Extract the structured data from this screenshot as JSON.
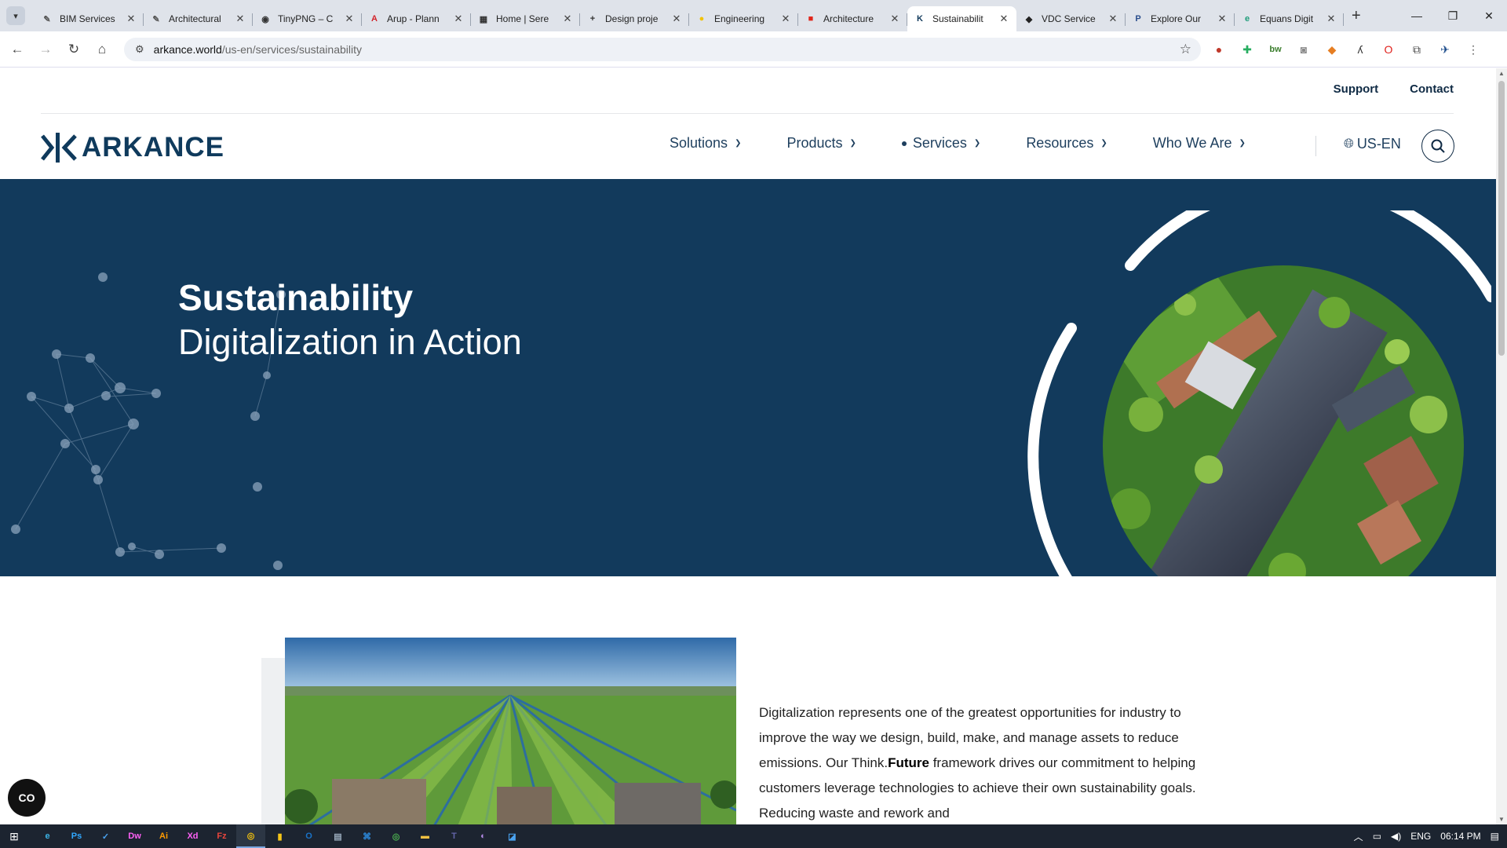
{
  "browser": {
    "tabs": [
      {
        "title": "BIM Services",
        "fav": "✎",
        "fav_color": "#555"
      },
      {
        "title": "Architectural",
        "fav": "✎",
        "fav_color": "#555"
      },
      {
        "title": "TinyPNG – C",
        "fav": "◉",
        "fav_color": "#333"
      },
      {
        "title": "Arup - Plann",
        "fav": "A",
        "fav_color": "#d2232a"
      },
      {
        "title": "Home | Sere",
        "fav": "▦",
        "fav_color": "#333"
      },
      {
        "title": "Design proje",
        "fav": "+",
        "fav_color": "#333"
      },
      {
        "title": "Engineering",
        "fav": "●",
        "fav_color": "#f2c200"
      },
      {
        "title": "Architecture",
        "fav": "■",
        "fav_color": "#e0261b"
      },
      {
        "title": "Sustainabilit",
        "fav": "K",
        "fav_color": "#123a5c",
        "active": true
      },
      {
        "title": "VDC Service",
        "fav": "◆",
        "fav_color": "#222"
      },
      {
        "title": "Explore Our",
        "fav": "P",
        "fav_color": "#2a4e8c"
      },
      {
        "title": "Equans Digit",
        "fav": "e",
        "fav_color": "#1f9d7a"
      }
    ],
    "new_tab": "+",
    "url_host": "arkance.world",
    "url_path": "/us-en/services/sustainability"
  },
  "site": {
    "util_links": [
      "Support",
      "Contact"
    ],
    "logo_text": "ARKANCE",
    "nav": [
      {
        "label": "Solutions"
      },
      {
        "label": "Products"
      },
      {
        "label": "Services",
        "active": true
      },
      {
        "label": "Resources"
      },
      {
        "label": "Who We Are"
      }
    ],
    "locale": "US-EN",
    "hero": {
      "title": "Sustainability",
      "subtitle": "Digitalization in Action"
    },
    "body": {
      "p1_a": "Digitalization represents one of the greatest opportunities for industry to improve the way we design, build, make, and manage assets to reduce emissions. Our Think.",
      "p1_bold": "Future",
      "p1_b": " framework drives our commitment to helping customers leverage technologies to achieve their own sustainability goals. Reducing waste and rework and"
    },
    "a11y_label": "CO"
  },
  "taskbar": {
    "apps": [
      {
        "label": "e",
        "color": "#3cb4e6"
      },
      {
        "label": "Ps",
        "color": "#31a8ff"
      },
      {
        "label": "✓",
        "color": "#4aa3f0"
      },
      {
        "label": "Dw",
        "color": "#ff61f6"
      },
      {
        "label": "Ai",
        "color": "#ff9a00"
      },
      {
        "label": "Xd",
        "color": "#ff61f6"
      },
      {
        "label": "Fz",
        "color": "#e8453c"
      },
      {
        "label": "◎",
        "color": "#f4c20d",
        "running": true
      },
      {
        "label": "▮",
        "color": "#f5c518"
      },
      {
        "label": "O",
        "color": "#1a73c8"
      },
      {
        "label": "▤",
        "color": "#9ab"
      },
      {
        "label": "⌘",
        "color": "#2d8fe6"
      },
      {
        "label": "◎",
        "color": "#4caf50"
      },
      {
        "label": "▬",
        "color": "#f4c242"
      },
      {
        "label": "T",
        "color": "#6264a7"
      },
      {
        "label": "◐",
        "color": "#b48be8"
      },
      {
        "label": "◪",
        "color": "#4aa3f0"
      }
    ],
    "lang": "ENG",
    "time": "06:14 PM"
  }
}
